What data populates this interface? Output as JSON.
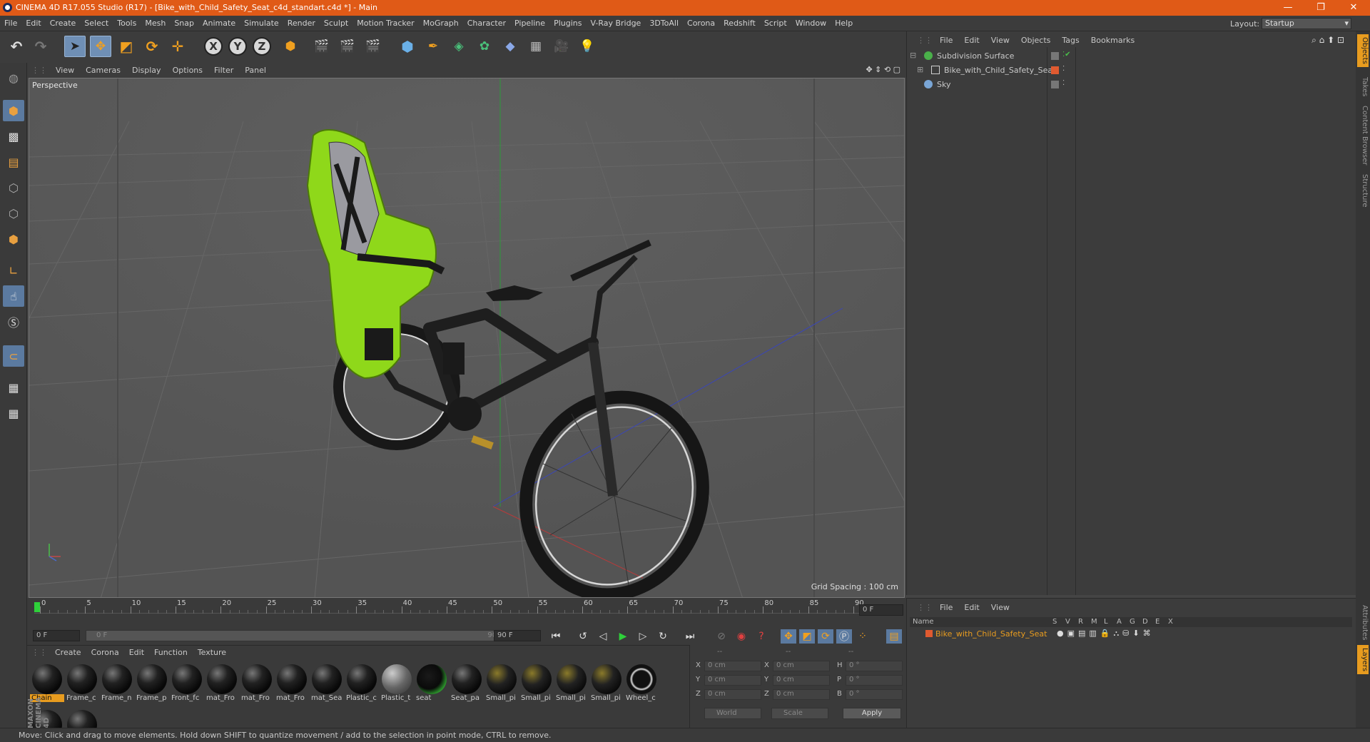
{
  "window": {
    "title": "CINEMA 4D R17.055 Studio (R17) - [Bike_with_Child_Safety_Seat_c4d_standart.c4d *] - Main",
    "controls": [
      "—",
      "❐",
      "✕"
    ]
  },
  "menubar": {
    "items": [
      "File",
      "Edit",
      "Create",
      "Select",
      "Tools",
      "Mesh",
      "Snap",
      "Animate",
      "Simulate",
      "Render",
      "Sculpt",
      "Motion Tracker",
      "MoGraph",
      "Character",
      "Pipeline",
      "Plugins",
      "V-Ray Bridge",
      "3DToAll",
      "Corona",
      "Redshift",
      "Script",
      "Window",
      "Help"
    ],
    "layout_label": "Layout:",
    "layout_value": "Startup"
  },
  "toolbar": {
    "axis_x": "X",
    "axis_y": "Y",
    "axis_z": "Z"
  },
  "viewport": {
    "menu": [
      "View",
      "Cameras",
      "Display",
      "Options",
      "Filter",
      "Panel"
    ],
    "name": "Perspective",
    "grid_spacing": "Grid Spacing : 100 cm"
  },
  "timeline": {
    "ticks": [
      "0",
      "5",
      "10",
      "15",
      "20",
      "25",
      "30",
      "35",
      "40",
      "45",
      "50",
      "55",
      "60",
      "65",
      "70",
      "75",
      "80",
      "85",
      "90"
    ],
    "current_frame_right": "0 F",
    "start_field": "0 F",
    "range_start": "0 F",
    "range_end": "90 F",
    "end_field": "90 F"
  },
  "material_manager": {
    "menu": [
      "Create",
      "Corona",
      "Edit",
      "Function",
      "Texture"
    ],
    "materials": [
      "Chain",
      "Frame_c",
      "Frame_n",
      "Frame_p",
      "Front_fc",
      "mat_Fro",
      "mat_Fro",
      "mat_Fro",
      "mat_Sea",
      "Plastic_c",
      "Plastic_t",
      "seat",
      "Seat_pa",
      "Small_pi",
      "Small_pi",
      "Small_pi",
      "Small_pi",
      "Wheel_c"
    ],
    "selected_index": 0
  },
  "coordinates": {
    "headers": [
      "--",
      "--",
      "--"
    ],
    "rows": [
      {
        "a": "X",
        "av": "0 cm",
        "b": "X",
        "bv": "0 cm",
        "c": "H",
        "cv": "0 °"
      },
      {
        "a": "Y",
        "av": "0 cm",
        "b": "Y",
        "bv": "0 cm",
        "c": "P",
        "cv": "0 °"
      },
      {
        "a": "Z",
        "av": "0 cm",
        "b": "Z",
        "bv": "0 cm",
        "c": "B",
        "cv": "0 °"
      }
    ],
    "mode_world": "World",
    "mode_scale": "Scale",
    "apply": "Apply"
  },
  "object_manager": {
    "menu": [
      "File",
      "Edit",
      "View",
      "Objects",
      "Tags",
      "Bookmarks"
    ],
    "objects": [
      {
        "name": "Subdivision Surface",
        "icon_color": "#4ab04a"
      },
      {
        "name": "Bike_with_Child_Safety_Seat",
        "icon_color": "#d0d0d0"
      },
      {
        "name": "Sky",
        "icon_color": "#7aa6d6"
      }
    ]
  },
  "layer_manager": {
    "menu": [
      "File",
      "Edit",
      "View"
    ],
    "columns": [
      "Name",
      "S",
      "V",
      "R",
      "M",
      "L",
      "A",
      "G",
      "D",
      "E",
      "X"
    ],
    "layer_name": "Bike_with_Child_Safety_Seat",
    "layer_color": "#e05a30"
  },
  "side_tabs": [
    "Objects",
    "Takes",
    "Content Browser",
    "Structure",
    "Attributes",
    "Layers"
  ],
  "status": {
    "text": "Move: Click and drag to move elements. Hold down SHIFT to quantize movement / add to the selection in point mode, CTRL to remove."
  },
  "branding": "MAXON CINEMA 4D",
  "colors": {
    "accent": "#e05a17",
    "selection": "#e89c1f",
    "seat_green": "#8fd81a"
  }
}
